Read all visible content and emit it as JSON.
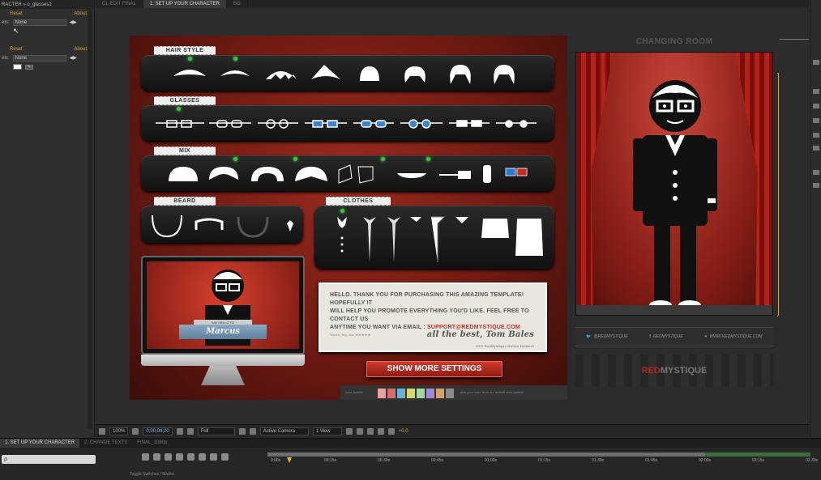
{
  "left_panel": {
    "rows": [
      {
        "type": "title",
        "text": "RACTER » o_glasses1"
      },
      {
        "type": "resetabout",
        "reset": "Reset",
        "about": "About..."
      },
      {
        "type": "select",
        "label": "ets:",
        "value": "None"
      },
      {
        "type": "blank"
      },
      {
        "type": "blank"
      },
      {
        "type": "resetabout",
        "reset": "Reset",
        "about": "About..."
      },
      {
        "type": "select",
        "label": "ets:",
        "value": "None"
      },
      {
        "type": "swatch"
      }
    ]
  },
  "comp_tabs": [
    {
      "label": "CL-EDIT FINAL",
      "active": false
    },
    {
      "label": "1. SET UP YOUR CHARACTER",
      "active": true
    },
    {
      "label": "BG",
      "active": false
    }
  ],
  "template": {
    "tags": {
      "hair": "HAIR STYLE",
      "glasses": "GLASSES",
      "mix": "MIX",
      "beard": "BEARD",
      "clothes": "CLOTHES"
    },
    "note": {
      "line1": "HELLO. THANK YOU FOR PURCHASING THIS AMAZING TEMPLATE! HOPEFULLY IT",
      "line2": "WILL HELP YOU PROMOTE EVERYTHING YOU'D LIKE. FEEL FREE TO CONTACT US",
      "line3_prefix": "ANYTIME YOU WANT VIA EMAIL :",
      "email": "SUPPORT@REDMYSTIQUE.COM",
      "signature": "all the best, Tom Bales",
      "sig_small": "CEO RedMystique Motion Network",
      "small_left": "Yours, Sly Joe ★★★★★"
    },
    "show_more": "SHOW MORE SETTINGS",
    "palette_left": "color palette",
    "palette_right": "pick your color from our default color palette",
    "palette_colors": [
      "#e8a0a0",
      "#d86a6a",
      "#6ab0d8",
      "#d8d86a",
      "#a0d8a0",
      "#a08ad8",
      "#d8a06a",
      "#8a8a8a"
    ],
    "monitor": {
      "ribbon_top": "SAY HELLO TO",
      "name": "Marcus"
    },
    "room": {
      "title": "CHANGING ROOM",
      "social": [
        {
          "icon": "twitter-icon",
          "text": "@REDMYSTIQUE"
        },
        {
          "icon": "facebook-icon",
          "text": "REDMYSTIQUE"
        },
        {
          "icon": "heart-icon",
          "text": "WWW.REDMYSTIQUE.COM"
        }
      ],
      "brand_red": "RED",
      "brand_rest": "MYSTIQUE"
    }
  },
  "viewer_bar": {
    "zoom": "100%",
    "timecode": "0;00;04;20",
    "resolution": "Full",
    "camera": "Active Camera",
    "view": "1 View",
    "offset": "+0.0"
  },
  "timeline": {
    "tabs": [
      {
        "label": "1. SET UP YOUR CHARACTER",
        "active": true
      },
      {
        "label": "2. CHANGE TEXTS",
        "active": false
      },
      {
        "label": "FINAL_1080p",
        "active": false
      }
    ],
    "search_placeholder": "ρ",
    "ticks": [
      "0:00s",
      "00:15s",
      "00:30s",
      "00:45s",
      "01:00s",
      "01:15s",
      "01:30s",
      "01:45s",
      "02:00s",
      "02:15s",
      "02:30s"
    ],
    "toggle": "Toggle Switches / Modes"
  },
  "colors": {
    "accent_orange": "#d8a43a",
    "template_red": "#c0322a",
    "green_dot": "#3ec13e"
  }
}
